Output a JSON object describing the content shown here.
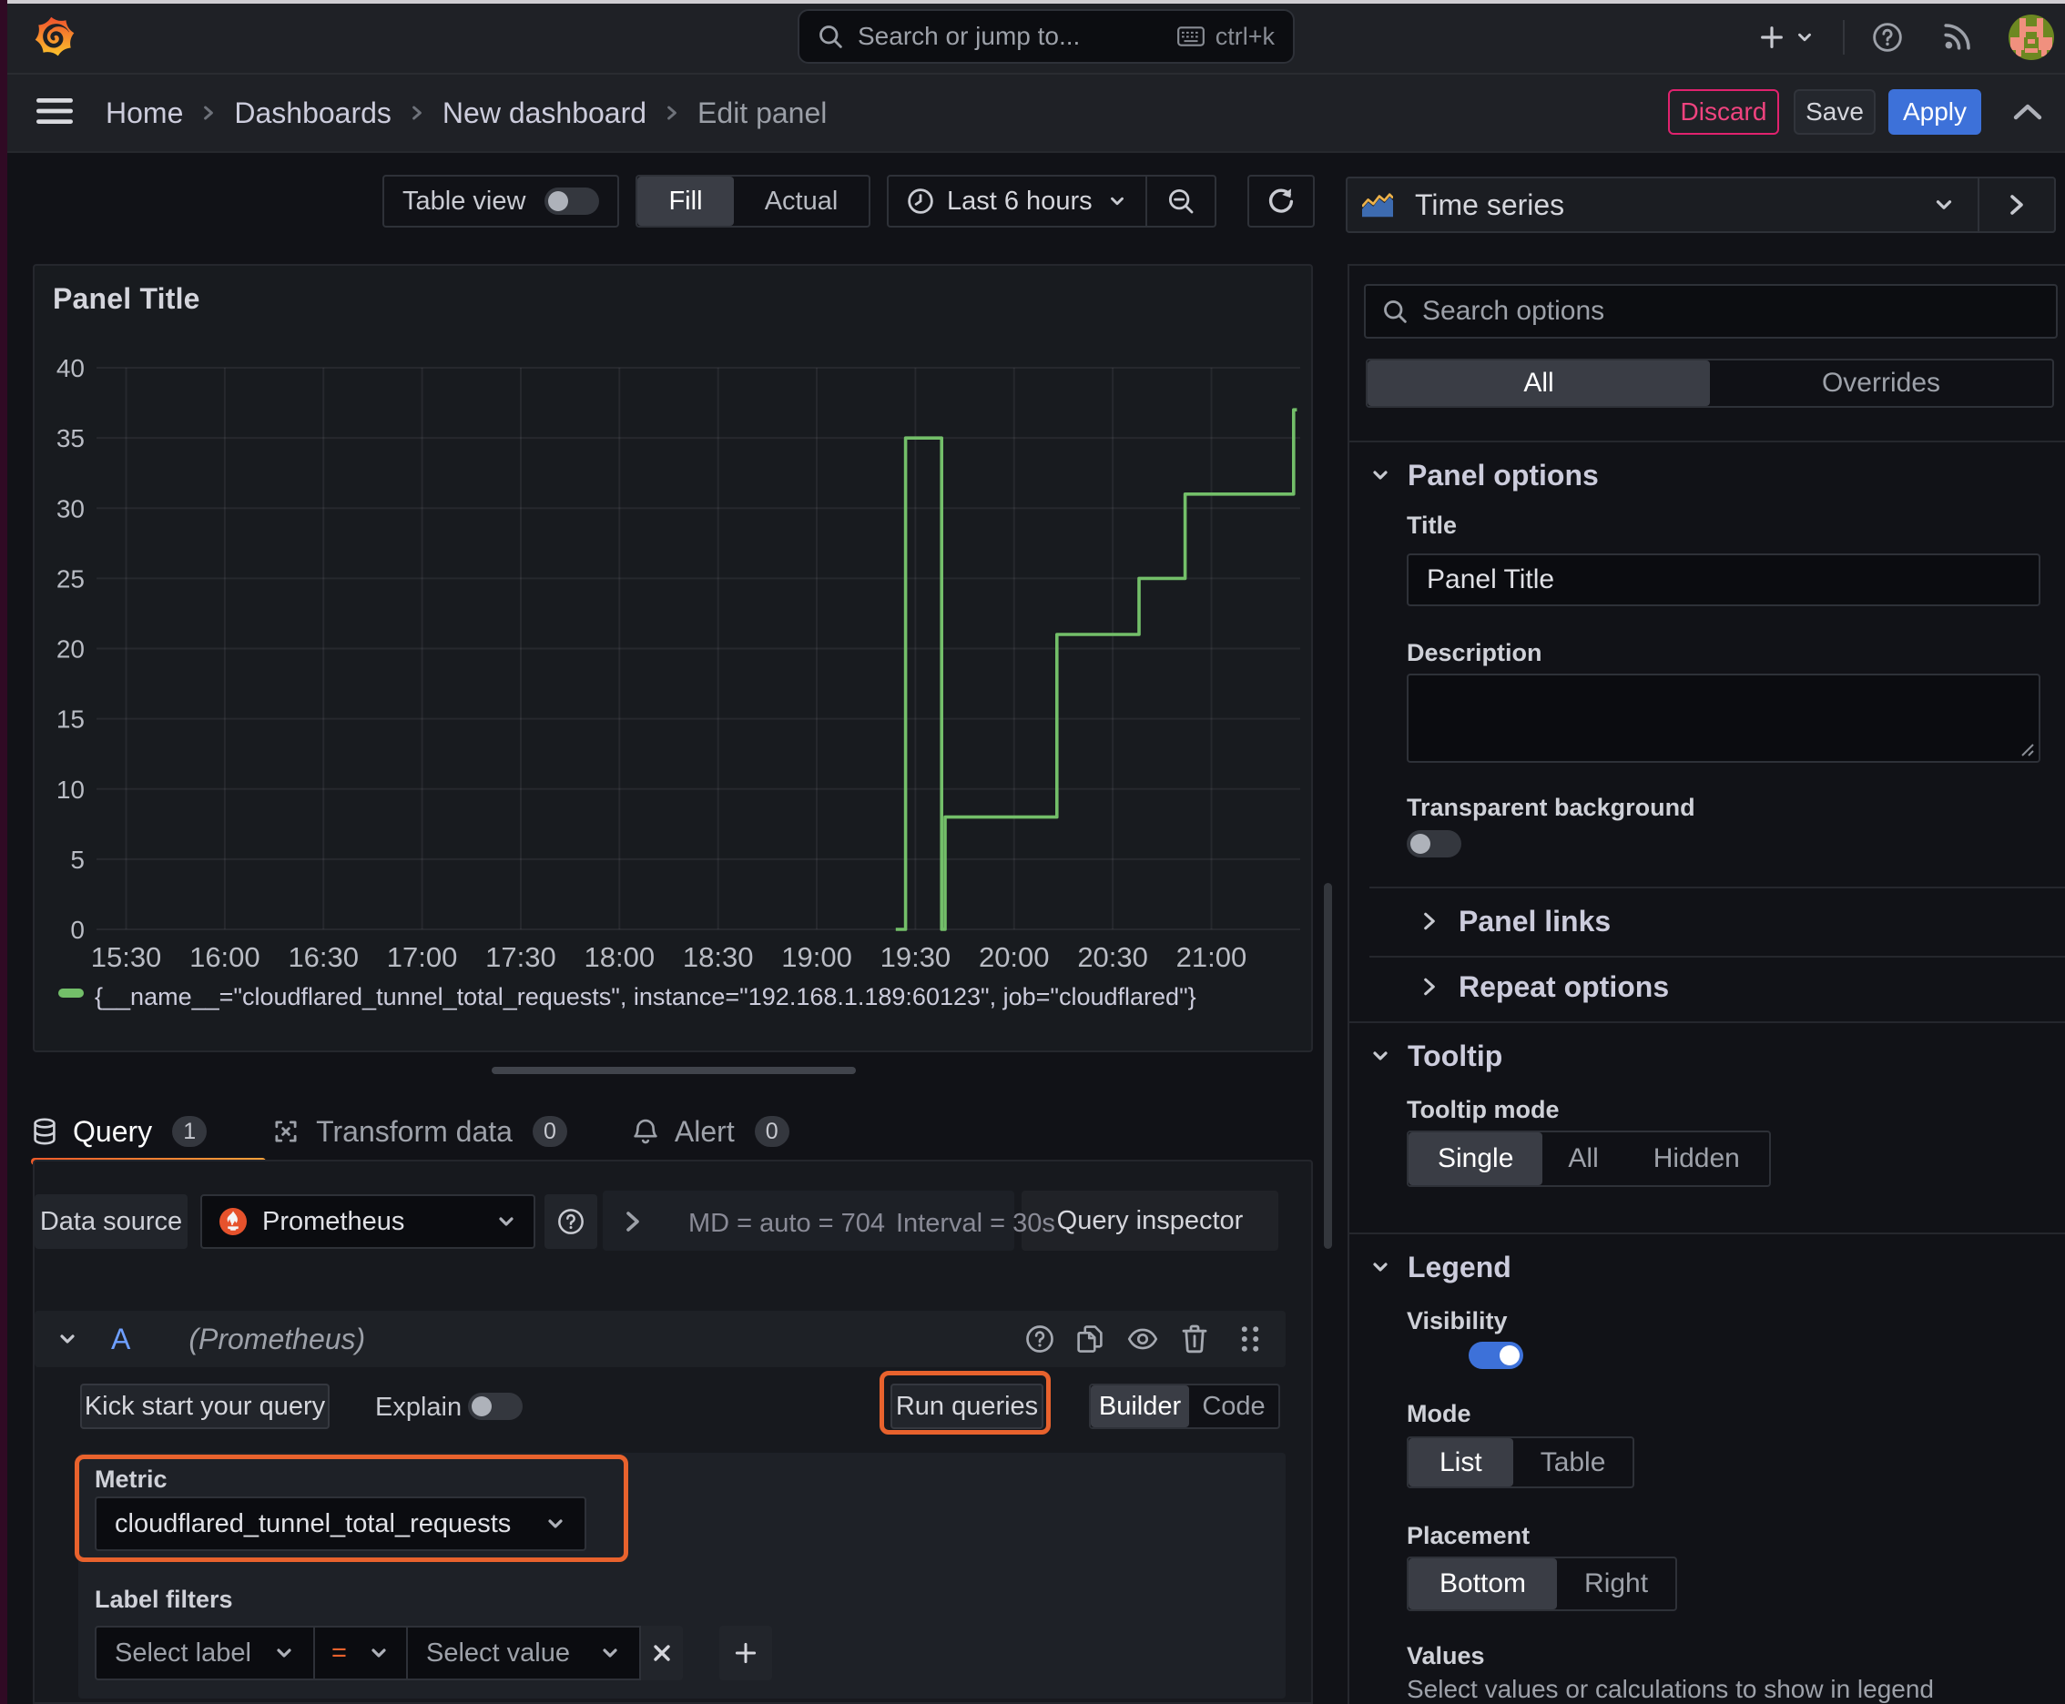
{
  "window": {
    "top_strip_color": "#d0ced2",
    "desktop_edge_color": "#300a24"
  },
  "navbar": {
    "search": {
      "placeholder": "Search or jump to...",
      "shortcut": "ctrl+k"
    }
  },
  "breadcrumb": {
    "items": [
      {
        "label": "Home"
      },
      {
        "label": "Dashboards"
      },
      {
        "label": "New dashboard"
      },
      {
        "label": "Edit panel"
      }
    ]
  },
  "actions": {
    "discard": "Discard",
    "save": "Save",
    "apply": "Apply",
    "discard_color": "#e0226e",
    "apply_color": "#3d71d9"
  },
  "toolbar": {
    "table_view": "Table view",
    "fill": "Fill",
    "actual": "Actual",
    "time_range": "Last 6 hours"
  },
  "panel": {
    "title": "Panel Title"
  },
  "chart_data": {
    "type": "line",
    "line_interpolation": "step-after",
    "title": "Panel Title",
    "xlabel": "",
    "ylabel": "",
    "x_range": [
      "15:21",
      "21:27"
    ],
    "x_ticks": [
      "15:30",
      "16:00",
      "16:30",
      "17:00",
      "17:30",
      "18:00",
      "18:30",
      "19:00",
      "19:30",
      "20:00",
      "20:30",
      "21:00"
    ],
    "ylim": [
      0,
      40
    ],
    "y_ticks": [
      0,
      5,
      10,
      15,
      20,
      25,
      30,
      35,
      40
    ],
    "grid": true,
    "legend_position": "bottom",
    "series": [
      {
        "name": "{__name__=\"cloudflared_tunnel_total_requests\", instance=\"192.168.1.189:60123\", job=\"cloudflared\"}",
        "color": "#73bf69",
        "steps": [
          [
            "19:24",
            0
          ],
          [
            "19:27",
            35
          ],
          [
            "19:38",
            0
          ],
          [
            "19:39",
            8
          ],
          [
            "20:13",
            21
          ],
          [
            "20:38",
            25
          ],
          [
            "20:52",
            31
          ],
          [
            "21:25",
            37
          ]
        ],
        "end_time": "21:26"
      }
    ]
  },
  "editor": {
    "tabs": [
      {
        "label": "Query",
        "count": "1"
      },
      {
        "label": "Transform data",
        "count": "0"
      },
      {
        "label": "Alert",
        "count": "0"
      }
    ],
    "datasource_label": "Data source",
    "datasource_name": "Prometheus",
    "stats_md": "MD = auto = 704",
    "stats_interval": "Interval = 30s",
    "query_inspector": "Query inspector",
    "row_ref": "A",
    "row_hint": "(Prometheus)",
    "kick_start": "Kick start your query",
    "explain": "Explain",
    "run_queries": "Run queries",
    "builder": "Builder",
    "code": "Code",
    "metric_label": "Metric",
    "metric_value": "cloudflared_tunnel_total_requests",
    "label_filters_label": "Label filters",
    "select_label_placeholder": "Select label",
    "operator": "=",
    "select_value_placeholder": "Select value"
  },
  "options_pane": {
    "visualization": "Time series",
    "search_placeholder": "Search options",
    "tab_all": "All",
    "tab_overrides": "Overrides",
    "panel_options": {
      "header": "Panel options",
      "title_label": "Title",
      "title_value": "Panel Title",
      "description_label": "Description",
      "transparent_label": "Transparent background",
      "panel_links": "Panel links",
      "repeat_options": "Repeat options"
    },
    "tooltip": {
      "header": "Tooltip",
      "mode_label": "Tooltip mode",
      "options": [
        "Single",
        "All",
        "Hidden"
      ],
      "selected": "Single"
    },
    "legend": {
      "header": "Legend",
      "visibility_label": "Visibility",
      "mode_label": "Mode",
      "mode_options": [
        "List",
        "Table"
      ],
      "mode_selected": "List",
      "placement_label": "Placement",
      "placement_options": [
        "Bottom",
        "Right"
      ],
      "placement_selected": "Bottom",
      "values_label": "Values",
      "values_hint": "Select values or calculations to show in legend"
    }
  },
  "colors": {
    "accent_orange": "#e8622d",
    "series_green": "#73bf69",
    "primary_blue": "#3d71d9",
    "destructive_pink": "#e0226e",
    "prometheus_orange": "#e6522c"
  }
}
